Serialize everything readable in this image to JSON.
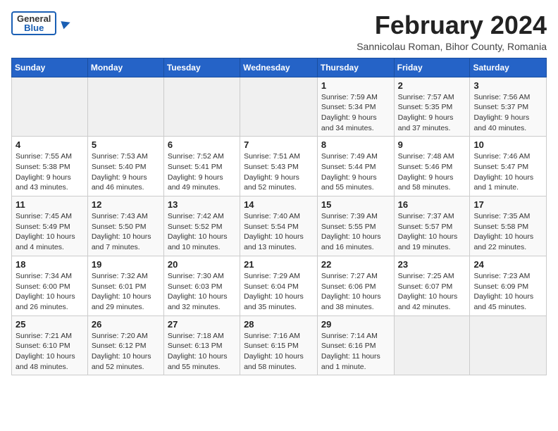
{
  "header": {
    "logo": {
      "general": "General",
      "blue": "Blue",
      "bird_symbol": "▶"
    },
    "title": "February 2024",
    "subtitle": "Sannicolau Roman, Bihor County, Romania"
  },
  "calendar": {
    "days_of_week": [
      "Sunday",
      "Monday",
      "Tuesday",
      "Wednesday",
      "Thursday",
      "Friday",
      "Saturday"
    ],
    "weeks": [
      [
        {
          "day": "",
          "info": ""
        },
        {
          "day": "",
          "info": ""
        },
        {
          "day": "",
          "info": ""
        },
        {
          "day": "",
          "info": ""
        },
        {
          "day": "1",
          "info": "Sunrise: 7:59 AM\nSunset: 5:34 PM\nDaylight: 9 hours\nand 34 minutes."
        },
        {
          "day": "2",
          "info": "Sunrise: 7:57 AM\nSunset: 5:35 PM\nDaylight: 9 hours\nand 37 minutes."
        },
        {
          "day": "3",
          "info": "Sunrise: 7:56 AM\nSunset: 5:37 PM\nDaylight: 9 hours\nand 40 minutes."
        }
      ],
      [
        {
          "day": "4",
          "info": "Sunrise: 7:55 AM\nSunset: 5:38 PM\nDaylight: 9 hours\nand 43 minutes."
        },
        {
          "day": "5",
          "info": "Sunrise: 7:53 AM\nSunset: 5:40 PM\nDaylight: 9 hours\nand 46 minutes."
        },
        {
          "day": "6",
          "info": "Sunrise: 7:52 AM\nSunset: 5:41 PM\nDaylight: 9 hours\nand 49 minutes."
        },
        {
          "day": "7",
          "info": "Sunrise: 7:51 AM\nSunset: 5:43 PM\nDaylight: 9 hours\nand 52 minutes."
        },
        {
          "day": "8",
          "info": "Sunrise: 7:49 AM\nSunset: 5:44 PM\nDaylight: 9 hours\nand 55 minutes."
        },
        {
          "day": "9",
          "info": "Sunrise: 7:48 AM\nSunset: 5:46 PM\nDaylight: 9 hours\nand 58 minutes."
        },
        {
          "day": "10",
          "info": "Sunrise: 7:46 AM\nSunset: 5:47 PM\nDaylight: 10 hours\nand 1 minute."
        }
      ],
      [
        {
          "day": "11",
          "info": "Sunrise: 7:45 AM\nSunset: 5:49 PM\nDaylight: 10 hours\nand 4 minutes."
        },
        {
          "day": "12",
          "info": "Sunrise: 7:43 AM\nSunset: 5:50 PM\nDaylight: 10 hours\nand 7 minutes."
        },
        {
          "day": "13",
          "info": "Sunrise: 7:42 AM\nSunset: 5:52 PM\nDaylight: 10 hours\nand 10 minutes."
        },
        {
          "day": "14",
          "info": "Sunrise: 7:40 AM\nSunset: 5:54 PM\nDaylight: 10 hours\nand 13 minutes."
        },
        {
          "day": "15",
          "info": "Sunrise: 7:39 AM\nSunset: 5:55 PM\nDaylight: 10 hours\nand 16 minutes."
        },
        {
          "day": "16",
          "info": "Sunrise: 7:37 AM\nSunset: 5:57 PM\nDaylight: 10 hours\nand 19 minutes."
        },
        {
          "day": "17",
          "info": "Sunrise: 7:35 AM\nSunset: 5:58 PM\nDaylight: 10 hours\nand 22 minutes."
        }
      ],
      [
        {
          "day": "18",
          "info": "Sunrise: 7:34 AM\nSunset: 6:00 PM\nDaylight: 10 hours\nand 26 minutes."
        },
        {
          "day": "19",
          "info": "Sunrise: 7:32 AM\nSunset: 6:01 PM\nDaylight: 10 hours\nand 29 minutes."
        },
        {
          "day": "20",
          "info": "Sunrise: 7:30 AM\nSunset: 6:03 PM\nDaylight: 10 hours\nand 32 minutes."
        },
        {
          "day": "21",
          "info": "Sunrise: 7:29 AM\nSunset: 6:04 PM\nDaylight: 10 hours\nand 35 minutes."
        },
        {
          "day": "22",
          "info": "Sunrise: 7:27 AM\nSunset: 6:06 PM\nDaylight: 10 hours\nand 38 minutes."
        },
        {
          "day": "23",
          "info": "Sunrise: 7:25 AM\nSunset: 6:07 PM\nDaylight: 10 hours\nand 42 minutes."
        },
        {
          "day": "24",
          "info": "Sunrise: 7:23 AM\nSunset: 6:09 PM\nDaylight: 10 hours\nand 45 minutes."
        }
      ],
      [
        {
          "day": "25",
          "info": "Sunrise: 7:21 AM\nSunset: 6:10 PM\nDaylight: 10 hours\nand 48 minutes."
        },
        {
          "day": "26",
          "info": "Sunrise: 7:20 AM\nSunset: 6:12 PM\nDaylight: 10 hours\nand 52 minutes."
        },
        {
          "day": "27",
          "info": "Sunrise: 7:18 AM\nSunset: 6:13 PM\nDaylight: 10 hours\nand 55 minutes."
        },
        {
          "day": "28",
          "info": "Sunrise: 7:16 AM\nSunset: 6:15 PM\nDaylight: 10 hours\nand 58 minutes."
        },
        {
          "day": "29",
          "info": "Sunrise: 7:14 AM\nSunset: 6:16 PM\nDaylight: 11 hours\nand 1 minute."
        },
        {
          "day": "",
          "info": ""
        },
        {
          "day": "",
          "info": ""
        }
      ]
    ]
  }
}
